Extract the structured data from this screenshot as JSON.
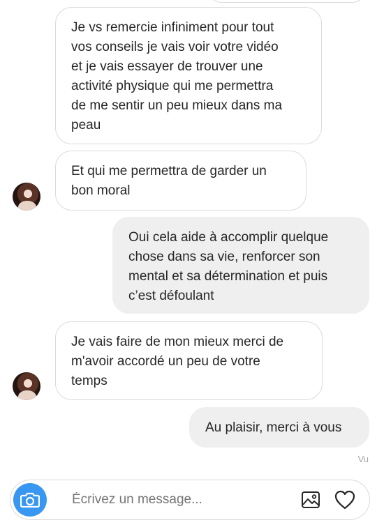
{
  "messages": [
    {
      "direction": "in",
      "text": "Je vs remercie infiniment pour tout\nvos conseils je vais voir votre vidéo\net je vais essayer de trouver une\nactivité physique qui me permettra\nde me sentir un peu mieux dans ma\npeau",
      "avatar": false
    },
    {
      "direction": "in",
      "text": "Et qui me permettra de garder un\nbon moral",
      "avatar": true
    },
    {
      "direction": "out",
      "text": "Oui cela aide à accomplir quelque\nchose dans sa vie, renforcer son\nmental et sa détermination et puis\nc’est défoulant"
    },
    {
      "direction": "in",
      "text": "Je vais faire de mon mieux merci de\nm'avoir accordé un peu de votre\ntemps",
      "avatar": true
    },
    {
      "direction": "out",
      "text": "Au plaisir, merci à vous"
    }
  ],
  "seen_label": "Vu",
  "composer": {
    "placeholder": "Écrivez un message...",
    "camera_icon": "camera-icon",
    "gallery_icon": "image-icon",
    "like_icon": "heart-icon",
    "accent": "#3897f0"
  }
}
